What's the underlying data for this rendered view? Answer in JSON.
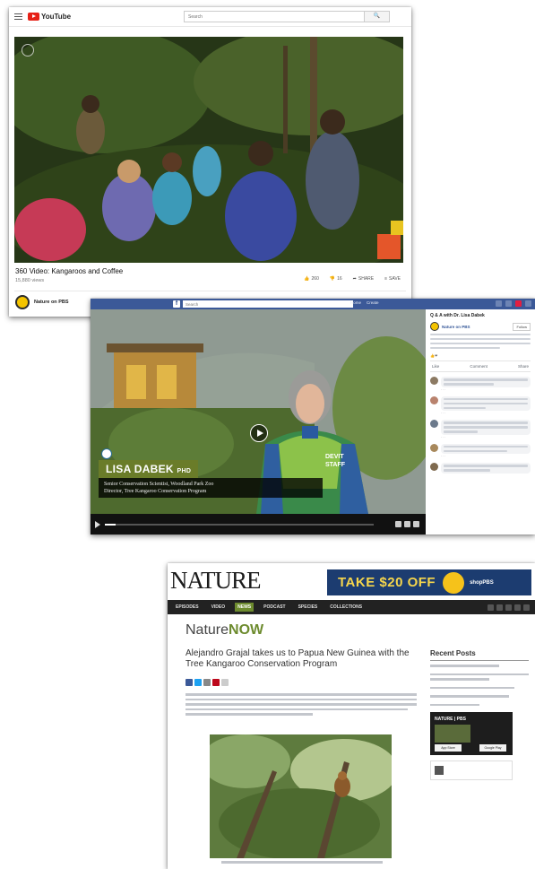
{
  "youtube": {
    "logo_text": "YouTube",
    "search_placeholder": "Search",
    "video_title": "360 Video: Kangaroos and Coffee",
    "views": "15,880 views",
    "actions": [
      {
        "icon": "thumbs-up-icon",
        "label": "260"
      },
      {
        "icon": "thumbs-down-icon",
        "label": "16"
      },
      {
        "icon": "share-icon",
        "label": "SHARE"
      },
      {
        "icon": "save-icon",
        "label": "SAVE"
      }
    ],
    "channel_name": "Nature on PBS"
  },
  "facebook": {
    "search_placeholder": "Search",
    "nav_items": [
      "Home",
      "Create"
    ],
    "panel_title": "Q & A with Dr. Lisa Dabek",
    "post_author": "Nature on PBS",
    "follow_label": "Follow",
    "actions": [
      "Like",
      "Comment",
      "Share"
    ],
    "video_overlay": {
      "name": "LISA DABEK",
      "suffix": "PHD",
      "role_line_1": "Senior Conservation Scientist, Woodland Park Zoo",
      "role_line_2": "Director, Tree Kangaroo Conservation Program"
    },
    "jacket_text_1": "DEVIT",
    "jacket_text_2": "STAFF",
    "progress": 0.04
  },
  "nature": {
    "logo": "NATURE",
    "ad_text": "TAKE $20 OFF",
    "nav_items": [
      "EPISODES",
      "VIDEO",
      "NEWS",
      "PODCAST",
      "SPECIES",
      "COLLECTIONS"
    ],
    "active_nav": "NEWS",
    "nature_now_prefix": "Nature",
    "nature_now_suffix": "NOW",
    "article_title": "Alejandro Grajal takes us to Papua New Guinea with the Tree Kangaroo Conservation Program",
    "sidebar_title": "Recent Posts",
    "colors": {
      "ad_bg": "#1c3c70",
      "ad_text": "#f6d64c",
      "accent_green": "#6d8b2e",
      "fb_blue": "#3b5998",
      "yt_red": "#e62117"
    }
  }
}
